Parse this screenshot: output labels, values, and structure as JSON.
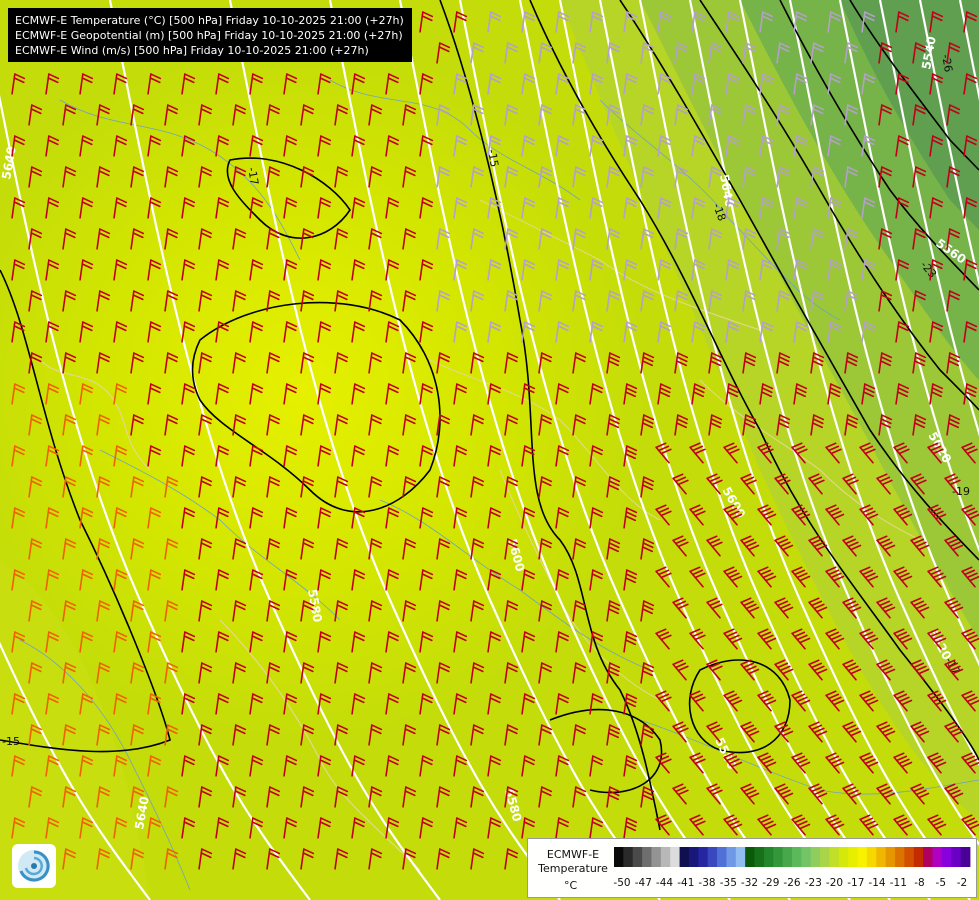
{
  "header": {
    "line1": "ECMWF-E Temperature (°C) [500 hPa] Friday 10-10-2025 21:00 (+27h)",
    "line2": "ECMWF-E Geopotential (m) [500 hPa] Friday 10-10-2025 21:00 (+27h)",
    "line3": "ECMWF-E Wind (m/s) [500 hPa] Friday 10-10-2025 21:00 (+27h)"
  },
  "legend": {
    "title_line1": "ECMWF-E",
    "title_line2": "Temperature",
    "unit": "°C",
    "ticks": [
      "-50",
      "-47",
      "-44",
      "-41",
      "-38",
      "-35",
      "-32",
      "-29",
      "-26",
      "-23",
      "-20",
      "-17",
      "-14",
      "-11",
      "-8",
      "-5",
      "-2"
    ],
    "colors": [
      "#0a0a0a",
      "#2a2a2a",
      "#4a4a4a",
      "#6e6e6e",
      "#939393",
      "#b8b8b8",
      "#dcdcdc",
      "#101050",
      "#18187a",
      "#2626a0",
      "#3a48c0",
      "#5070d8",
      "#6f98e6",
      "#92bdf0",
      "#0a5a0a",
      "#17701a",
      "#24862a",
      "#33983a",
      "#47a84b",
      "#5bb85b",
      "#72c466",
      "#8fcd5d",
      "#a9d648",
      "#c1df28",
      "#d6e70a",
      "#e7ee00",
      "#f7f200",
      "#f6d800",
      "#f0b700",
      "#e69600",
      "#dc7300",
      "#d24f00",
      "#c42b00",
      "#b00060",
      "#b000c0",
      "#8a00dc",
      "#6a00c4",
      "#4a0096"
    ]
  },
  "contour_labels": {
    "geopotential": [
      "5640",
      "5640",
      "5640",
      "5540",
      "5560",
      "5620",
      "5600",
      "5600",
      "5580",
      "5580",
      "5580",
      "5620"
    ],
    "temperature": [
      "-15",
      "-17",
      "-18",
      "-23",
      "-26",
      "-19",
      "-17",
      "-15"
    ]
  },
  "colors": {
    "background": "#cde200",
    "geopotential_contour": "#ffffff",
    "temperature_contour": "#000000",
    "wind_barb": "#c0001a",
    "wind_barb_strong": "#b4a0c8",
    "wind_barb_warm": "#f06000"
  }
}
